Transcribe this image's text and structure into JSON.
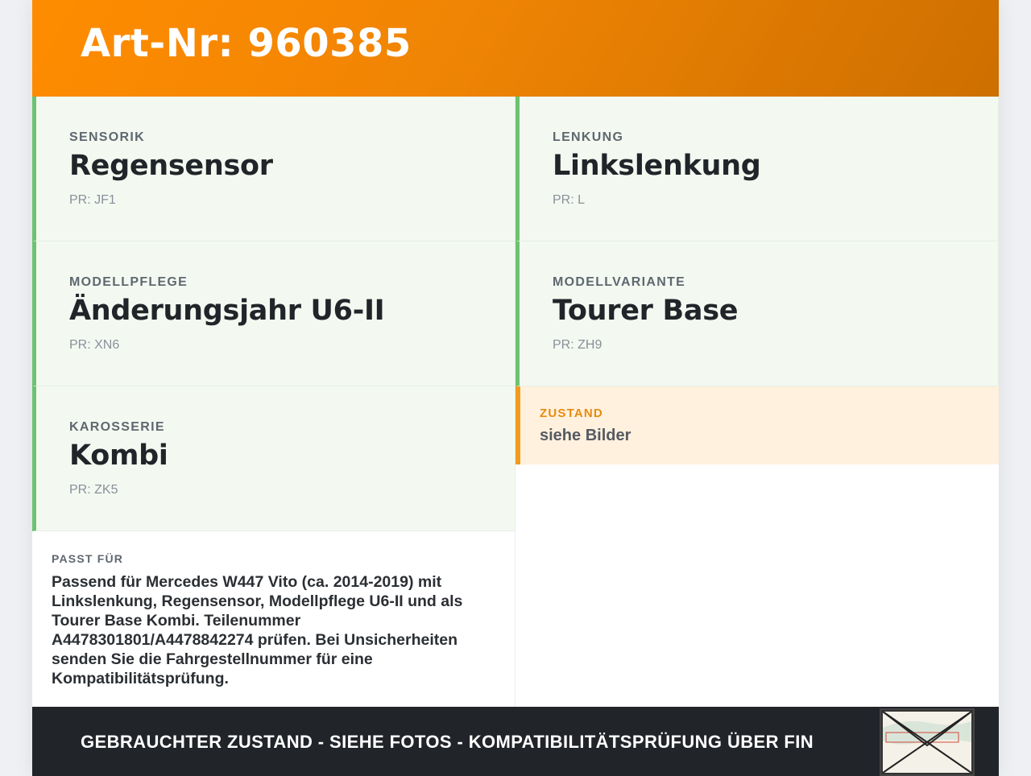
{
  "header": {
    "title": "Art-Nr: 960385"
  },
  "specs": [
    {
      "label": "SENSORIK",
      "value": "Regensensor",
      "code": "PR: JF1"
    },
    {
      "label": "LENKUNG",
      "value": "Linkslenkung",
      "code": "PR: L"
    },
    {
      "label": "MODELLPFLEGE",
      "value": "Änderungsjahr U6-II",
      "code": "PR: XN6"
    },
    {
      "label": "MODELLVARIANTE",
      "value": "Tourer Base",
      "code": "PR: ZH9"
    },
    {
      "label": "KAROSSERIE",
      "value": "Kombi",
      "code": "PR: ZK5"
    }
  ],
  "condition": {
    "label": "ZUSTAND",
    "value": "siehe Bilder"
  },
  "fits": {
    "label": "PASST FÜR",
    "text": "Passend für Mercedes W447 Vito (ca. 2014-2019) mit Linkslenkung, Regensensor, Modellpflege U6-II und als Tourer Base Kombi. Teilenummer A4478301801/A4478842274 prüfen. Bei Unsicherheiten senden Sie die Fahrgestellnummer für eine Kompatibilitätsprüfung."
  },
  "footer": {
    "banner": "GEBRAUCHTER ZUSTAND - SIEHE FOTOS - KOMPATIBILITÄTSPRÜFUNG ÜBER FIN",
    "thumbnail_icon": "envelope-label-photo-icon"
  },
  "colors": {
    "accent": "#ff8c00",
    "spec_border": "#6cc36f",
    "spec_bg": "#f3f9f1",
    "condition_bg": "#fff1de",
    "condition_border": "#f39a1f",
    "footer_bg": "#212429"
  }
}
